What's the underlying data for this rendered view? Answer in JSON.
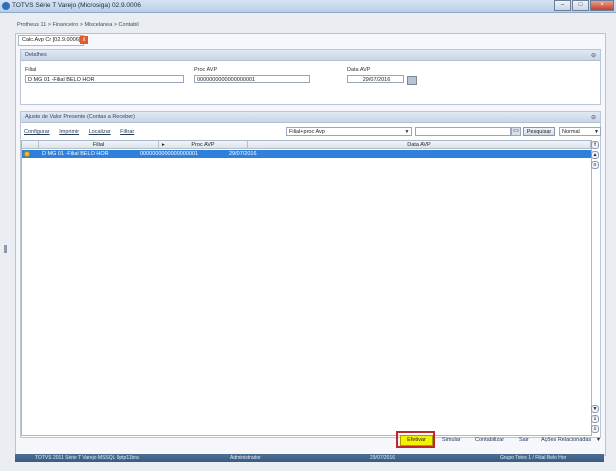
{
  "window": {
    "title": "TOTVS Série T Varejo (Microsiga) 02.9.0006"
  },
  "breadcrumb": "Protheus 11 > Financeiro > Miscelanea > Contabil",
  "tab": {
    "label": "Calc.Avp Cr [02.9.0006]",
    "close": "x"
  },
  "detalhes": {
    "title": "Detalhes",
    "filial_label": "Filial",
    "filial_value": "D MG 01 -Filial BELO HOR",
    "procavp_label": "Proc AVP",
    "procavp_value": "0000000000000000001",
    "dataavp_label": "Data AVP",
    "dataavp_value": "29/07/2016"
  },
  "ajuste": {
    "title": "Ajuste de Valor Presente (Contas a Receber)",
    "links": [
      "Configurar",
      "Imprimir",
      "Localizar",
      "Filtrar"
    ],
    "order_select": "Filial+proc Avp",
    "search_placeholder": "",
    "search_button": "Pesquisar",
    "view_select": "Normal"
  },
  "grid": {
    "columns": [
      "Filial",
      "Proc AVP",
      "Data AVP"
    ],
    "rows": [
      {
        "filial": "D MG 01 -Filial BELO HOR",
        "proc": "0000000000000000001",
        "data": "29/07/2016"
      }
    ]
  },
  "actions": {
    "efetivar": "Efetivar",
    "simular": "Simular",
    "contabilizar": "Contabilizar",
    "sair": "Sair",
    "acoes": "Ações Relacionadas"
  },
  "status": {
    "product": "TOTVS 2011 Série T Varejo MSSQL 9ptp11bra",
    "user": "Administrador",
    "date": "29/07/2016",
    "company": "Grupo Totvs 1 / Filial Belo Hor"
  },
  "colors": {
    "accent": "#2f80dc",
    "highlight": "#f3f000",
    "status_bar": "#3b5b82"
  }
}
